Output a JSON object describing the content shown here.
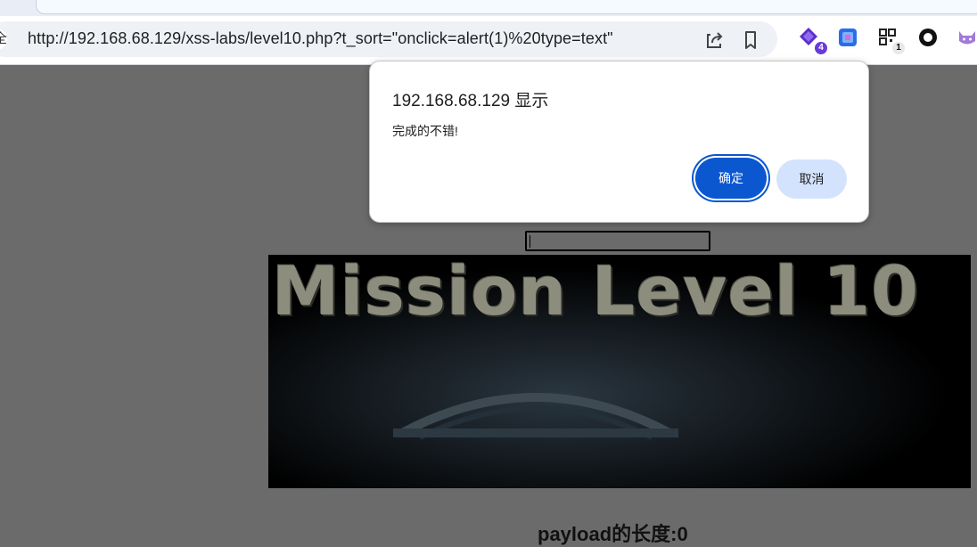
{
  "browser": {
    "security_chip_label": "全",
    "url": "http://192.168.68.129/xss-labs/level10.php?t_sort=\"onclick=alert(1)%20type=text\"",
    "extensions": [
      {
        "icon": "purple-diamond-extension-icon",
        "badge": "4",
        "badge_color": "#6a3bd8"
      },
      {
        "icon": "blue-square-extension-icon",
        "badge": ""
      },
      {
        "icon": "qr-code-extension-icon",
        "badge": "1",
        "badge_color": "#e8e8e8"
      },
      {
        "icon": "black-circle-extension-icon",
        "badge": ""
      },
      {
        "icon": "purple-cat-extension-icon",
        "badge": ""
      }
    ]
  },
  "page": {
    "banner_title": "Mission Level 10",
    "payload_length_label": "payload的长度:0"
  },
  "dialog": {
    "title": "192.168.68.129 显示",
    "message": "完成的不错!",
    "ok_label": "确定",
    "cancel_label": "取消"
  },
  "colors": {
    "overlay_background": "#6b6b6b",
    "primary_button": "#0b57d0",
    "secondary_button": "#d3e3fd"
  }
}
